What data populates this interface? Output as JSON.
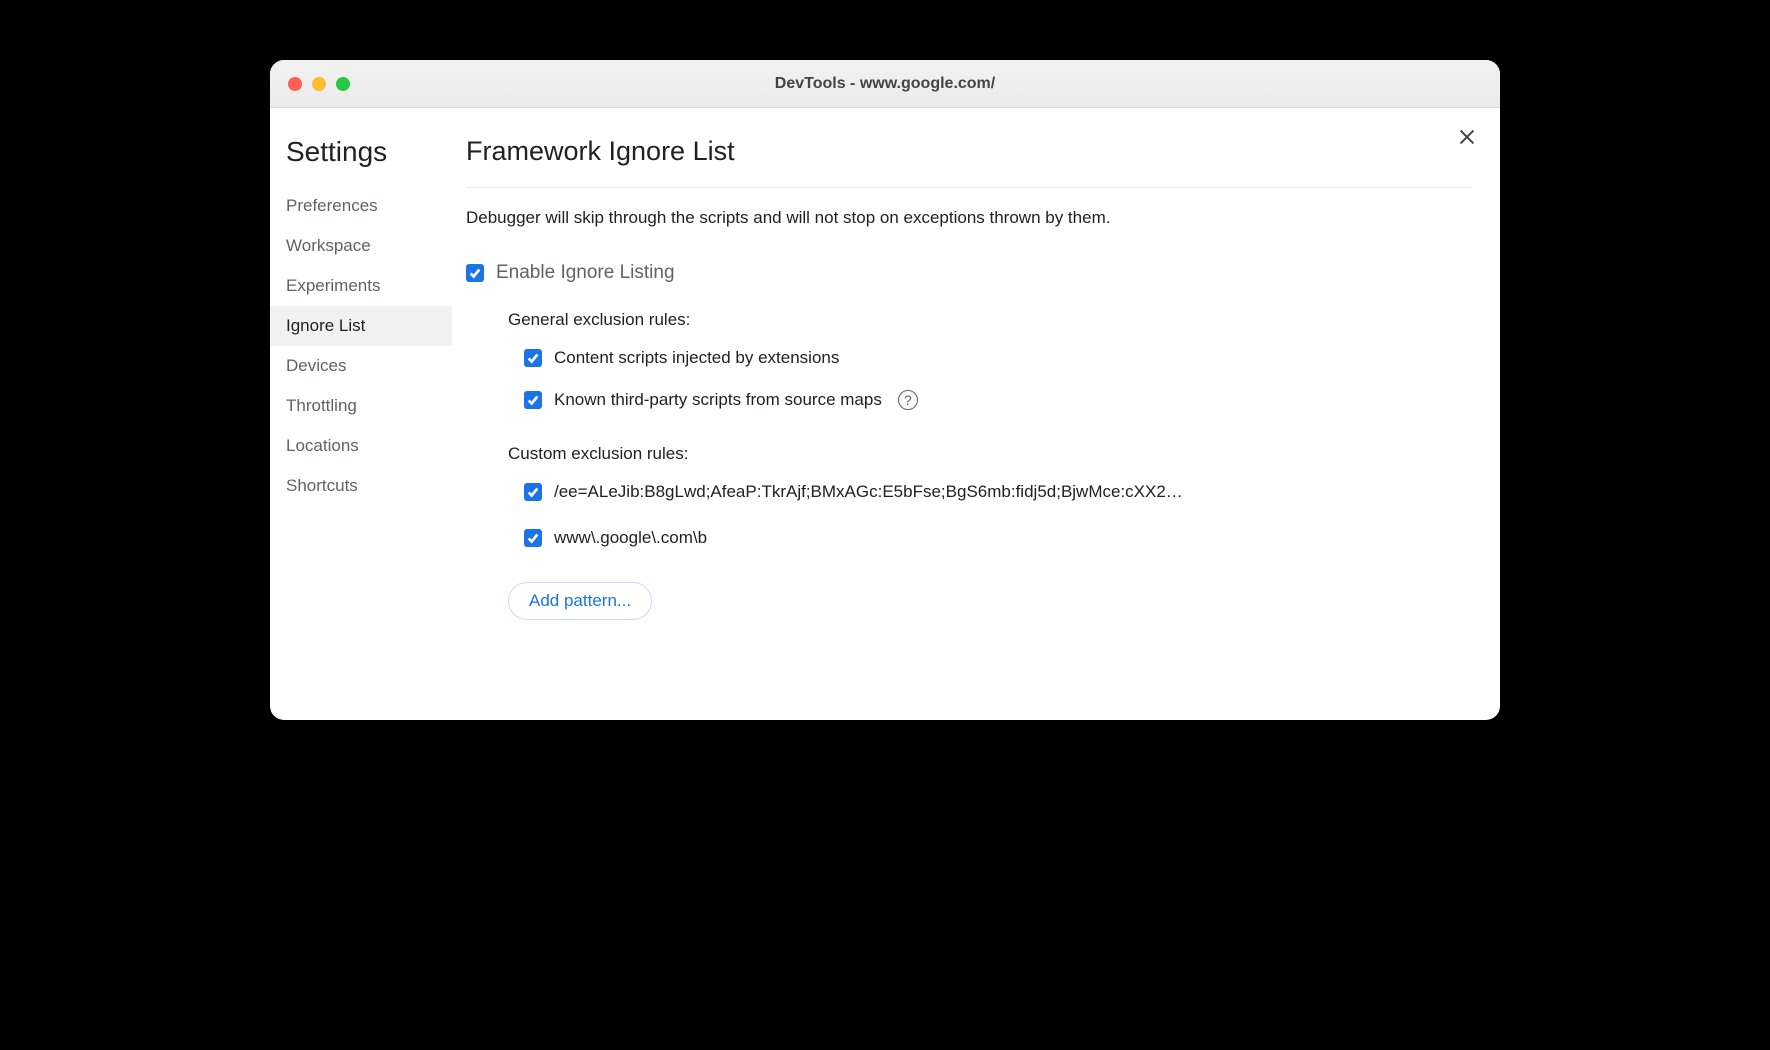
{
  "titlebar": {
    "title": "DevTools - www.google.com/"
  },
  "sidebar": {
    "title": "Settings",
    "items": [
      {
        "label": "Preferences",
        "selected": false
      },
      {
        "label": "Workspace",
        "selected": false
      },
      {
        "label": "Experiments",
        "selected": false
      },
      {
        "label": "Ignore List",
        "selected": true
      },
      {
        "label": "Devices",
        "selected": false
      },
      {
        "label": "Throttling",
        "selected": false
      },
      {
        "label": "Locations",
        "selected": false
      },
      {
        "label": "Shortcuts",
        "selected": false
      }
    ]
  },
  "main": {
    "heading": "Framework Ignore List",
    "description": "Debugger will skip through the scripts and will not stop on exceptions thrown by them.",
    "enable_label": "Enable Ignore Listing",
    "enable_checked": true,
    "general_section": "General exclusion rules:",
    "general_rules": [
      {
        "label": "Content scripts injected by extensions",
        "checked": true,
        "help": false
      },
      {
        "label": "Known third-party scripts from source maps",
        "checked": true,
        "help": true
      }
    ],
    "custom_section": "Custom exclusion rules:",
    "custom_rules": [
      {
        "pattern": "/ee=ALeJib:B8gLwd;AfeaP:TkrAjf;BMxAGc:E5bFse;BgS6mb:fidj5d;BjwMce:cXX2…",
        "checked": true
      },
      {
        "pattern": "www\\.google\\.com\\b",
        "checked": true
      }
    ],
    "add_pattern_label": "Add pattern..."
  }
}
